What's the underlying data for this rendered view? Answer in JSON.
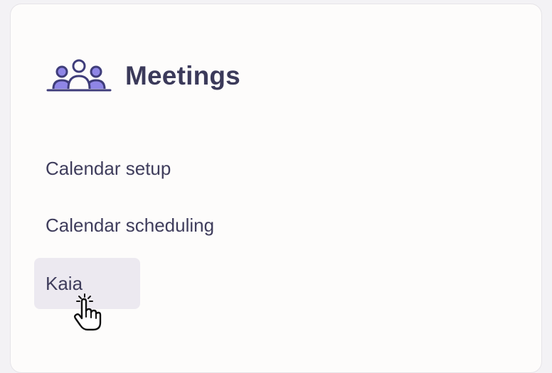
{
  "section": {
    "title": "Meetings",
    "icon": "people-group-icon"
  },
  "nav": {
    "items": [
      {
        "label": "Calendar setup",
        "active": false
      },
      {
        "label": "Calendar scheduling",
        "active": false
      },
      {
        "label": "Kaia",
        "active": true
      }
    ]
  },
  "colors": {
    "title": "#3b3a5a",
    "icon_stroke": "#3f3d7a",
    "icon_fill": "#8f86e6",
    "active_bg": "#ece9f0",
    "card_bg": "#fdfcfb"
  },
  "cursor": "hand-pointer-icon"
}
